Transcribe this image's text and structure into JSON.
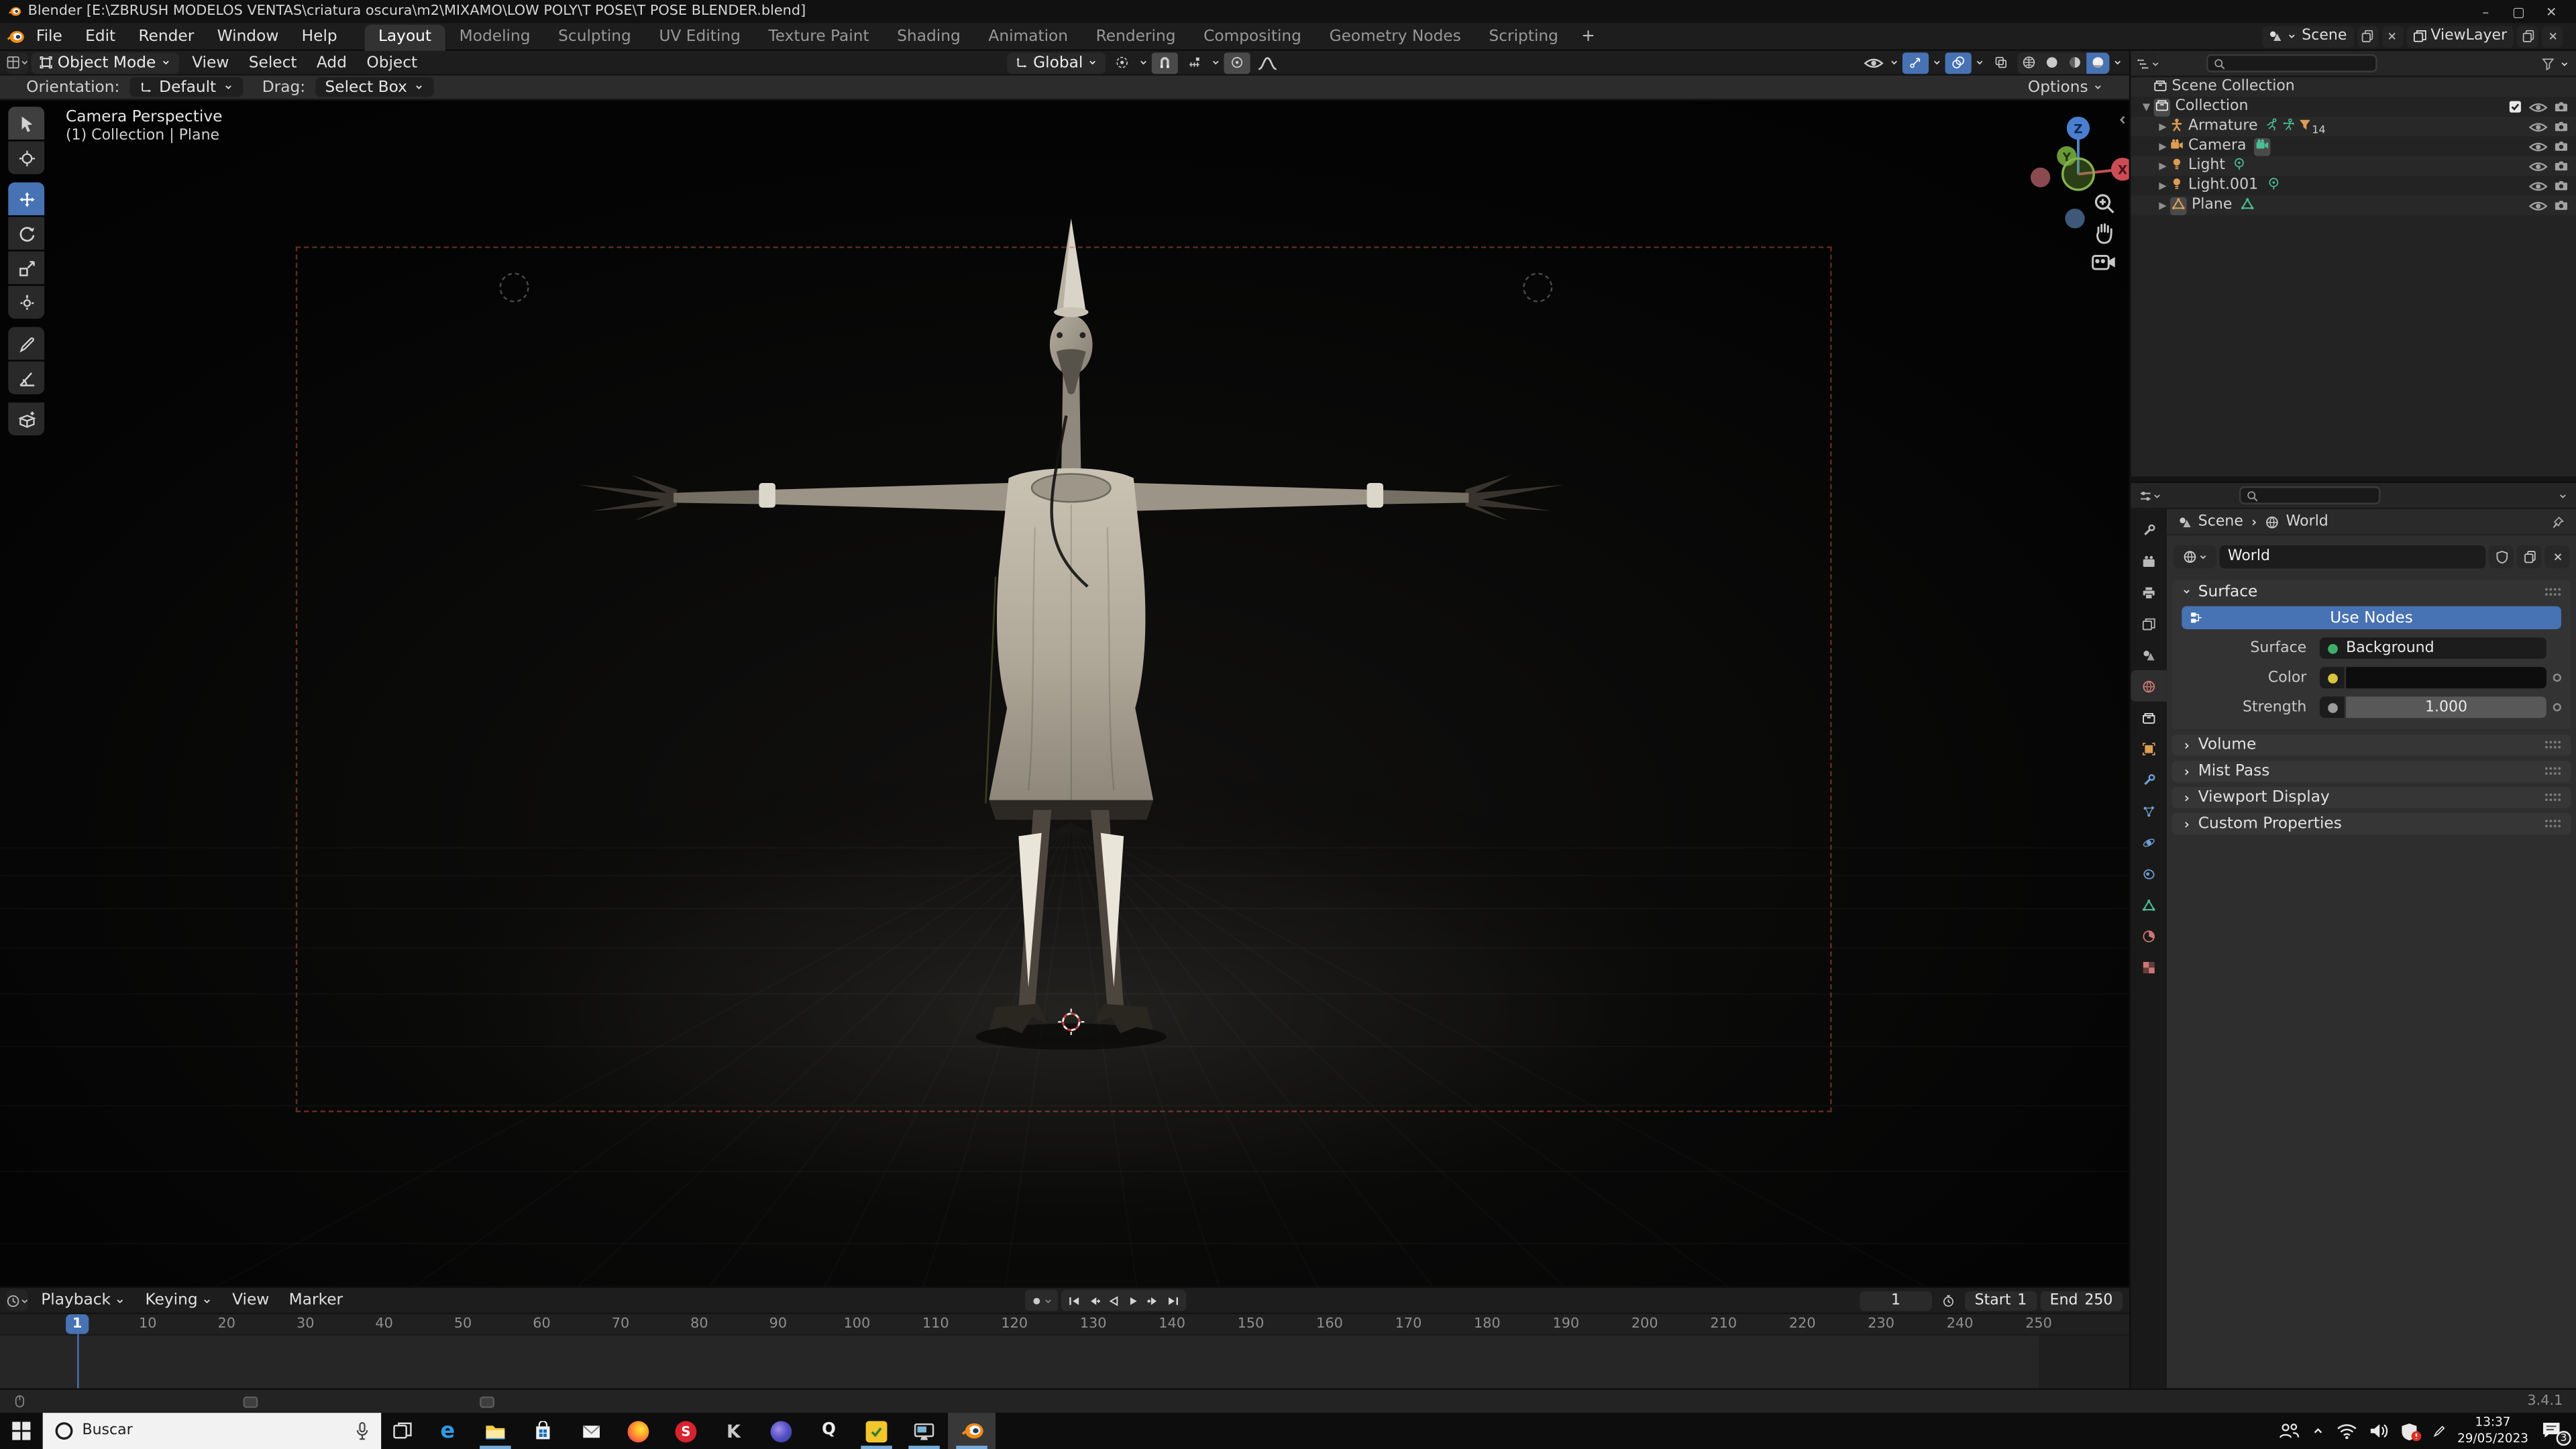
{
  "window": {
    "title": "Blender [E:\\ZBRUSH MODELOS VENTAS\\criatura oscura\\m2\\MIXAMO\\LOW POLY\\T POSE\\T POSE BLENDER.blend]"
  },
  "topbar": {
    "menus": [
      "File",
      "Edit",
      "Render",
      "Window",
      "Help"
    ],
    "workspaces": [
      "Layout",
      "Modeling",
      "Sculpting",
      "UV Editing",
      "Texture Paint",
      "Shading",
      "Animation",
      "Rendering",
      "Compositing",
      "Geometry Nodes",
      "Scripting"
    ],
    "active_workspace": "Layout",
    "add_workspace": "+",
    "scene_name": "Scene",
    "viewlayer_name": "ViewLayer"
  },
  "viewport": {
    "mode": "Object Mode",
    "menus": [
      "View",
      "Select",
      "Add",
      "Object"
    ],
    "orientation": "Global",
    "tool_settings": {
      "orientation_label": "Orientation:",
      "orientation_value": "Default",
      "drag_label": "Drag:",
      "drag_value": "Select Box",
      "options_label": "Options"
    },
    "overlay_top": "Camera Perspective",
    "overlay_bottom": "(1) Collection | Plane",
    "gizmo": {
      "z": "Z",
      "y": "Y",
      "x": "X"
    },
    "tools": [
      "select-box",
      "cursor",
      "move",
      "rotate",
      "scale",
      "transform",
      "annotate",
      "measure",
      "add-cube"
    ],
    "active_tool": "move"
  },
  "outliner": {
    "root": "Scene Collection",
    "collection": "Collection",
    "items": [
      {
        "name": "Armature",
        "type": "armature",
        "badge": "14"
      },
      {
        "name": "Camera",
        "type": "camera"
      },
      {
        "name": "Light",
        "type": "light"
      },
      {
        "name": "Light.001",
        "type": "light"
      },
      {
        "name": "Plane",
        "type": "mesh"
      }
    ]
  },
  "properties": {
    "breadcrumb": {
      "scene": "Scene",
      "world": "World"
    },
    "tabs": [
      {
        "name": "tool",
        "shape": "wrench",
        "color": "#b9b9b9"
      },
      {
        "name": "render",
        "shape": "cameraback",
        "color": "#b9b9b9"
      },
      {
        "name": "output",
        "shape": "printer",
        "color": "#b9b9b9"
      },
      {
        "name": "view-layer",
        "shape": "images",
        "color": "#b9b9b9"
      },
      {
        "name": "scene",
        "shape": "scene",
        "color": "#b9b9b9"
      },
      {
        "name": "world",
        "shape": "globe",
        "color": "#cd7672",
        "active": true
      },
      {
        "name": "collection",
        "shape": "boxicon",
        "color": "#e4e4e4"
      },
      {
        "name": "object",
        "shape": "square",
        "color": "#dd9d53"
      },
      {
        "name": "modifiers",
        "shape": "wrench",
        "color": "#6f9fd2"
      },
      {
        "name": "particles",
        "shape": "particles",
        "color": "#6f9fd2"
      },
      {
        "name": "physics",
        "shape": "orbit",
        "color": "#6f9fd2"
      },
      {
        "name": "constraints",
        "shape": "blob",
        "color": "#6f9fd2"
      },
      {
        "name": "object-data",
        "shape": "tri",
        "color": "#4dbd93"
      },
      {
        "name": "material",
        "shape": "pie",
        "color": "#cd7672"
      },
      {
        "name": "texture",
        "shape": "checker",
        "color": "#cd7672"
      }
    ],
    "datablock_name": "World",
    "surface_panel": "Surface",
    "use_nodes": "Use Nodes",
    "rows": {
      "surface_label": "Surface",
      "surface_value": "Background",
      "color_label": "Color",
      "strength_label": "Strength",
      "strength_value": "1.000"
    },
    "collapsed_panels": [
      "Volume",
      "Mist Pass",
      "Viewport Display",
      "Custom Properties"
    ]
  },
  "timeline": {
    "menus": [
      "Playback",
      "Keying",
      "View",
      "Marker"
    ],
    "current_frame": "1",
    "frame_field": "1",
    "start_label": "Start",
    "start_value": "1",
    "end_label": "End",
    "end_value": "250",
    "ticks": [
      10,
      20,
      30,
      40,
      50,
      60,
      70,
      80,
      90,
      100,
      110,
      120,
      130,
      140,
      150,
      160,
      170,
      180,
      190,
      200,
      210,
      220,
      230,
      240,
      250
    ]
  },
  "statusbar": {
    "version": "3.4.1"
  },
  "taskbar": {
    "search_placeholder": "Buscar",
    "clock_time": "13:37",
    "clock_date": "29/05/2023",
    "notification_count": "3",
    "apps": [
      {
        "name": "edge",
        "underline": false
      },
      {
        "name": "explorer",
        "underline": true
      },
      {
        "name": "store",
        "underline": false
      },
      {
        "name": "mail",
        "underline": false
      },
      {
        "name": "firefox",
        "underline": false
      },
      {
        "name": "red-s",
        "underline": false
      },
      {
        "name": "keyshot",
        "underline": false
      },
      {
        "name": "cinema4d",
        "underline": false
      },
      {
        "name": "q-app",
        "underline": false
      },
      {
        "name": "yellow-check",
        "underline": true
      },
      {
        "name": "monitor",
        "underline": true
      },
      {
        "name": "blender",
        "underline": true,
        "active": true
      }
    ]
  },
  "colors": {
    "accent": "#4772b3",
    "object_orange": "#dd9d53",
    "data_green": "#4dbd93",
    "world_red": "#cd7672"
  }
}
